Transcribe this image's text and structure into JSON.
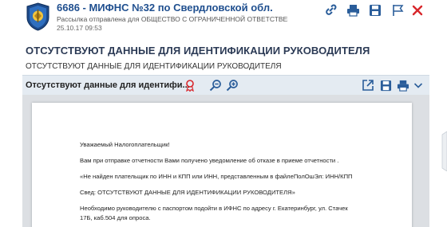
{
  "header": {
    "title": "6686 - МИФНС №32 по Свердловской обл.",
    "subtitle": "Рассылка отправлена для ОБЩЕСТВО С ОГРАНИЧЕННОЙ ОТВЕТСТВЕНН...",
    "date": "25.10.17 09:53"
  },
  "toolbar_icons": [
    "link-icon",
    "printer-icon",
    "save-icon",
    "flag-icon",
    "close-icon"
  ],
  "colors": {
    "brand_blue": "#1f4f8f",
    "close_red": "#d8262b",
    "bar_bg": "#e4ebf2"
  },
  "main_title": "ОТСУТСТВУЮТ ДАННЫЕ ДЛЯ ИДЕНТИФИКАЦИИ РУКОВОДИТЕЛЯ",
  "subject_line": "ОТСУТСТВУЮТ ДАННЫЕ ДЛЯ ИДЕНТИФИКАЦИИ РУКОВОДИТЕЛЯ",
  "document": {
    "name": "Отсутствуют данные для идентифи...",
    "lines": [
      "Уважаемый Налогоплательщик!",
      "Вам при отправке отчетности Вами получено уведомление об отказе в приеме отчетности .",
      "«Не найден плательщик по ИНН и КПП или ИНН, представленным в файлеПолОшЭл: ИНН/КПП",
      "Свед: ОТСУТСТВУЮТ ДАННЫЕ ДЛЯ ИДЕНТИФИКАЦИИ РУКОВОДИТЕЛЯ»",
      "Необходимо руководителю с паспортом подойти  в ИФНС по адресу г. Екатеринбург, ул. Стачек",
      "17Б, каб.504 для опроса."
    ]
  }
}
